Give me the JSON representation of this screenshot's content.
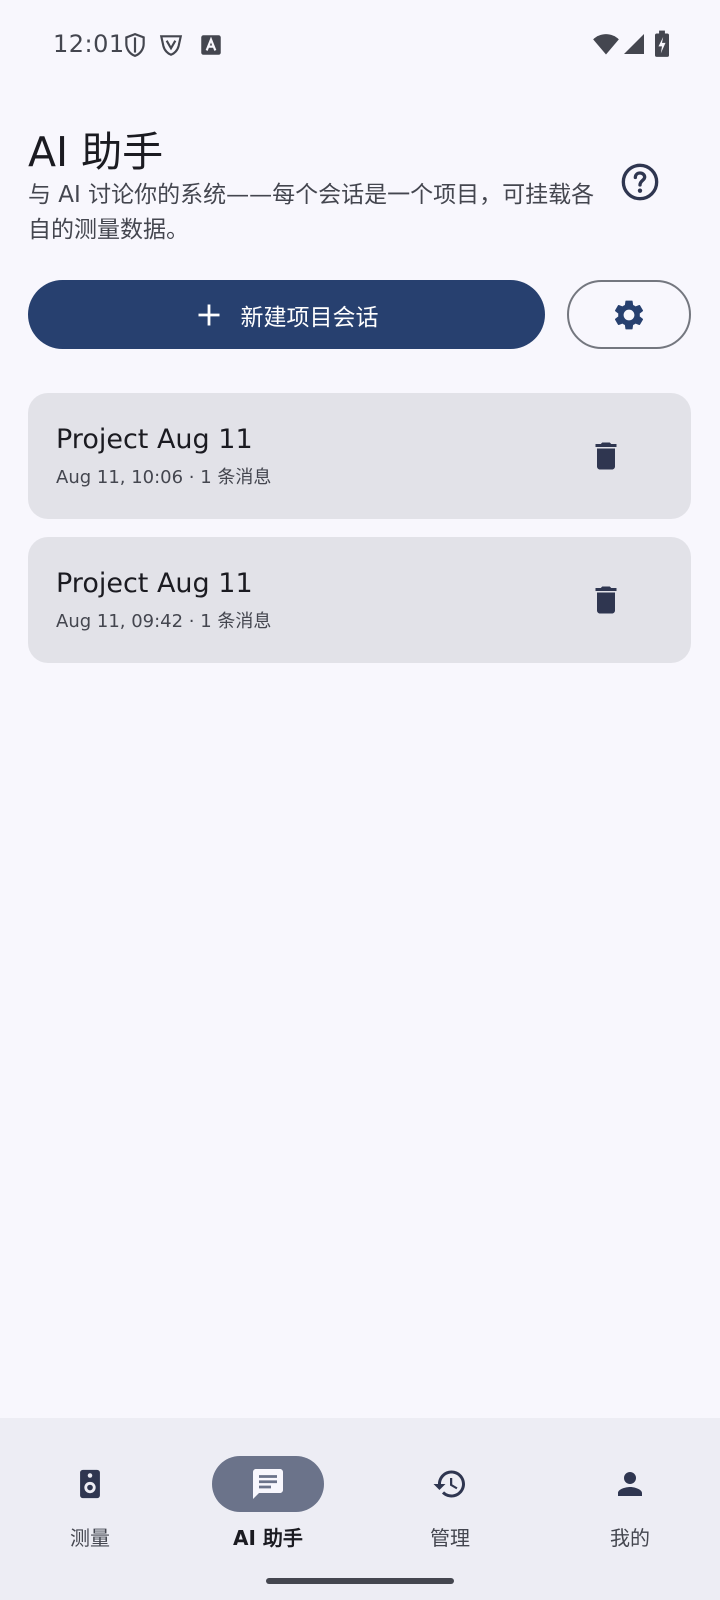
{
  "status_bar": {
    "time": "12:01",
    "icons_left": [
      "shield-icon",
      "vpn-badge-icon",
      "keyboard-a-icon"
    ],
    "icons_right": [
      "wifi-icon",
      "cellular-signal-icon",
      "battery-charging-icon"
    ]
  },
  "header": {
    "title": "AI 助手",
    "subtitle": "与 AI 讨论你的系统——每个会话是一个项目，可挂载各自的测量数据。",
    "help_icon": "help-circle-icon"
  },
  "actions": {
    "new_project_label": "新建项目会话",
    "new_project_icon": "plus-icon",
    "settings_icon": "gear-icon"
  },
  "sessions": [
    {
      "title": "Project Aug 11",
      "meta": "Aug 11, 10:06 · 1 条消息",
      "delete_icon": "trash-icon"
    },
    {
      "title": "Project Aug 11",
      "meta": "Aug 11, 09:42 · 1 条消息",
      "delete_icon": "trash-icon"
    }
  ],
  "bottom_nav": {
    "items": [
      {
        "label": "测量",
        "icon": "speaker-icon",
        "active": false
      },
      {
        "label": "AI 助手",
        "icon": "chat-icon",
        "active": true
      },
      {
        "label": "管理",
        "icon": "history-icon",
        "active": false
      },
      {
        "label": "我的",
        "icon": "person-icon",
        "active": false
      }
    ]
  },
  "colors": {
    "background": "#f8f7fd",
    "primary": "#27406f",
    "card": "#e2e2e8",
    "nav_background": "#ededf4",
    "nav_active_pill": "#6b738a",
    "icon_dark": "#2f3650"
  }
}
